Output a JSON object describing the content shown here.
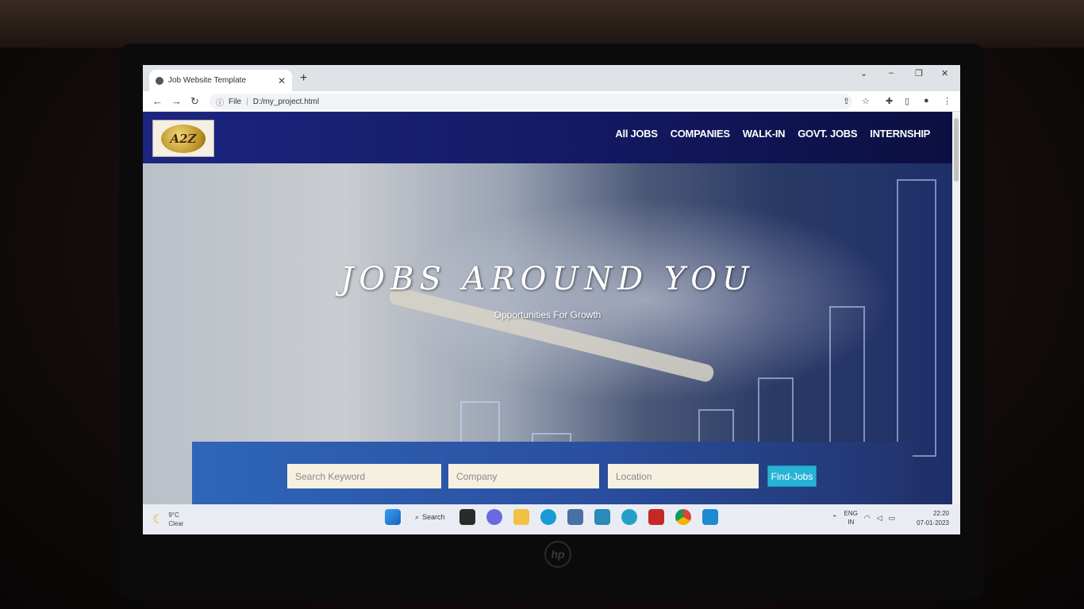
{
  "browser": {
    "tab_title": "Job Website Template",
    "address_scheme": "File",
    "address_path": "D:/my_project.html"
  },
  "site": {
    "logo_text": "A2Z",
    "nav": [
      "All JOBS",
      "COMPANIES",
      "WALK-IN",
      "GOVT. JOBS",
      "INTERNSHIP"
    ]
  },
  "hero": {
    "title": "JOBS AROUND YOU",
    "subtitle": "Opportunities For Growth"
  },
  "search": {
    "keyword_placeholder": "Search Keyword",
    "company_placeholder": "Company",
    "location_placeholder": "Location",
    "button_label": "Find-Jobs"
  },
  "taskbar": {
    "weather_temp": "9°C",
    "weather_desc": "Clear",
    "search_label": "Search",
    "lang_line1": "ENG",
    "lang_line2": "IN",
    "time": "22:20",
    "date": "07-01-2023"
  },
  "colors": {
    "header_bg": "#141b66",
    "search_panel": "#2a4fa0",
    "button": "#27b3d6"
  }
}
